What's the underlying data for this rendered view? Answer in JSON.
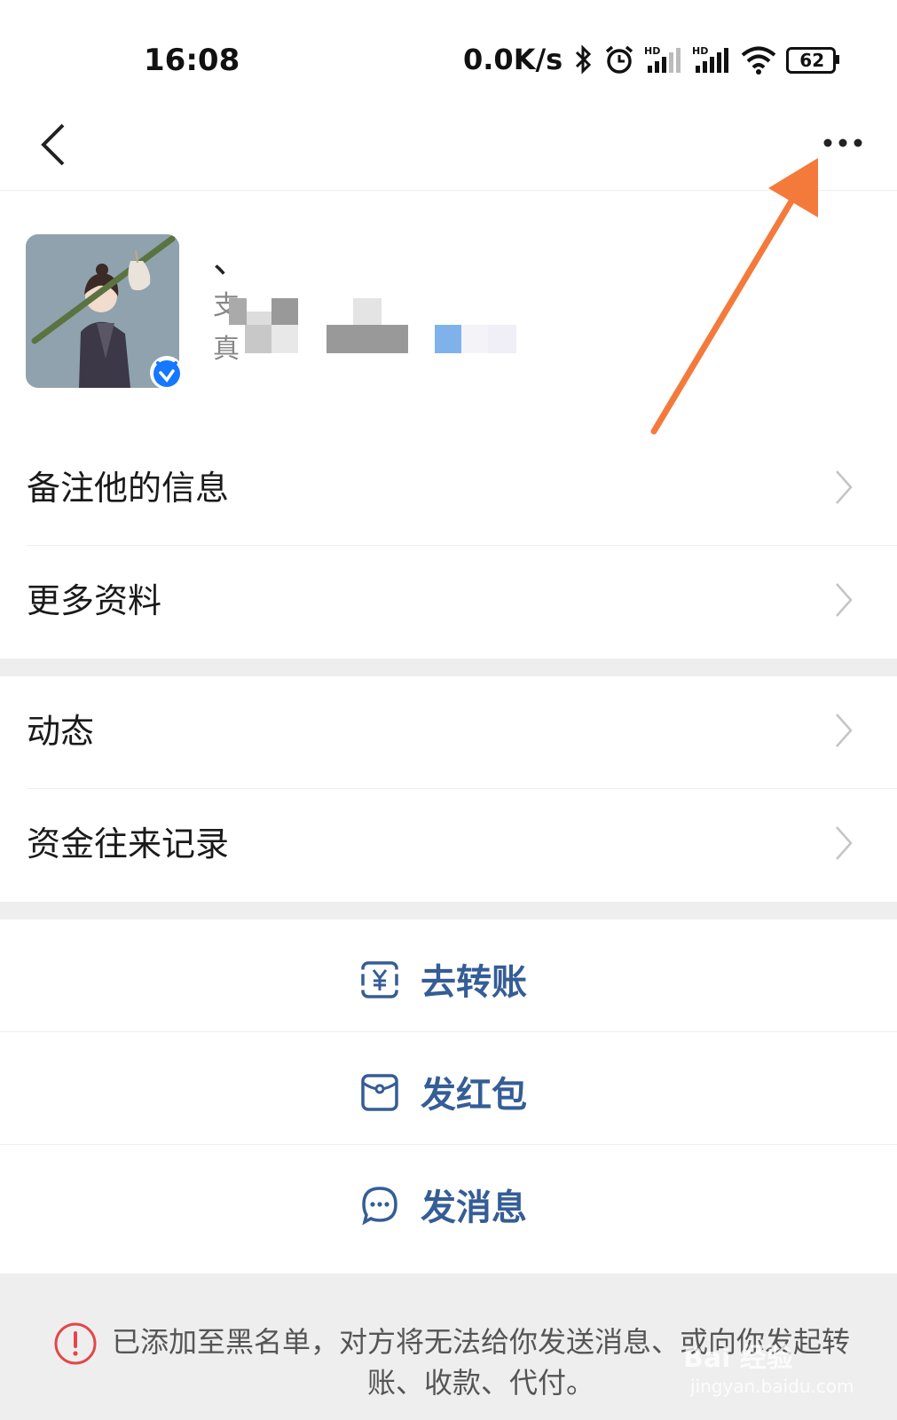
{
  "status_bar": {
    "time": "16:08",
    "net_speed": "0.0K/s",
    "battery": "62",
    "icons": [
      "bluetooth-icon",
      "alarm-icon",
      "signal-hd-icon",
      "signal-hd-icon",
      "wifi-icon",
      "battery-icon"
    ]
  },
  "nav": {
    "back_icon": "chevron-left-icon",
    "more_icon": "more-dots-icon"
  },
  "profile": {
    "name": "、",
    "line1_prefix": "支",
    "line2_prefix": "真",
    "verified_icon": "verified-badge-icon"
  },
  "menu": {
    "remark": "备注他的信息",
    "more_info": "更多资料",
    "moments": "动态",
    "fund_records": "资金往来记录"
  },
  "actions": {
    "transfer": "去转账",
    "red_packet": "发红包",
    "message": "发消息"
  },
  "notice": {
    "text": "已添加至黑名单，对方将无法给你发送消息、或向你发起转账、收款、代付。",
    "icon": "warning-icon"
  },
  "watermark": {
    "main": "Bai 经验",
    "sub": "jingyan.baidu.com"
  },
  "colors": {
    "accent": "#355d96",
    "arrow": "#f47a3c",
    "warning": "#e24848",
    "gap": "#eeeeee"
  }
}
